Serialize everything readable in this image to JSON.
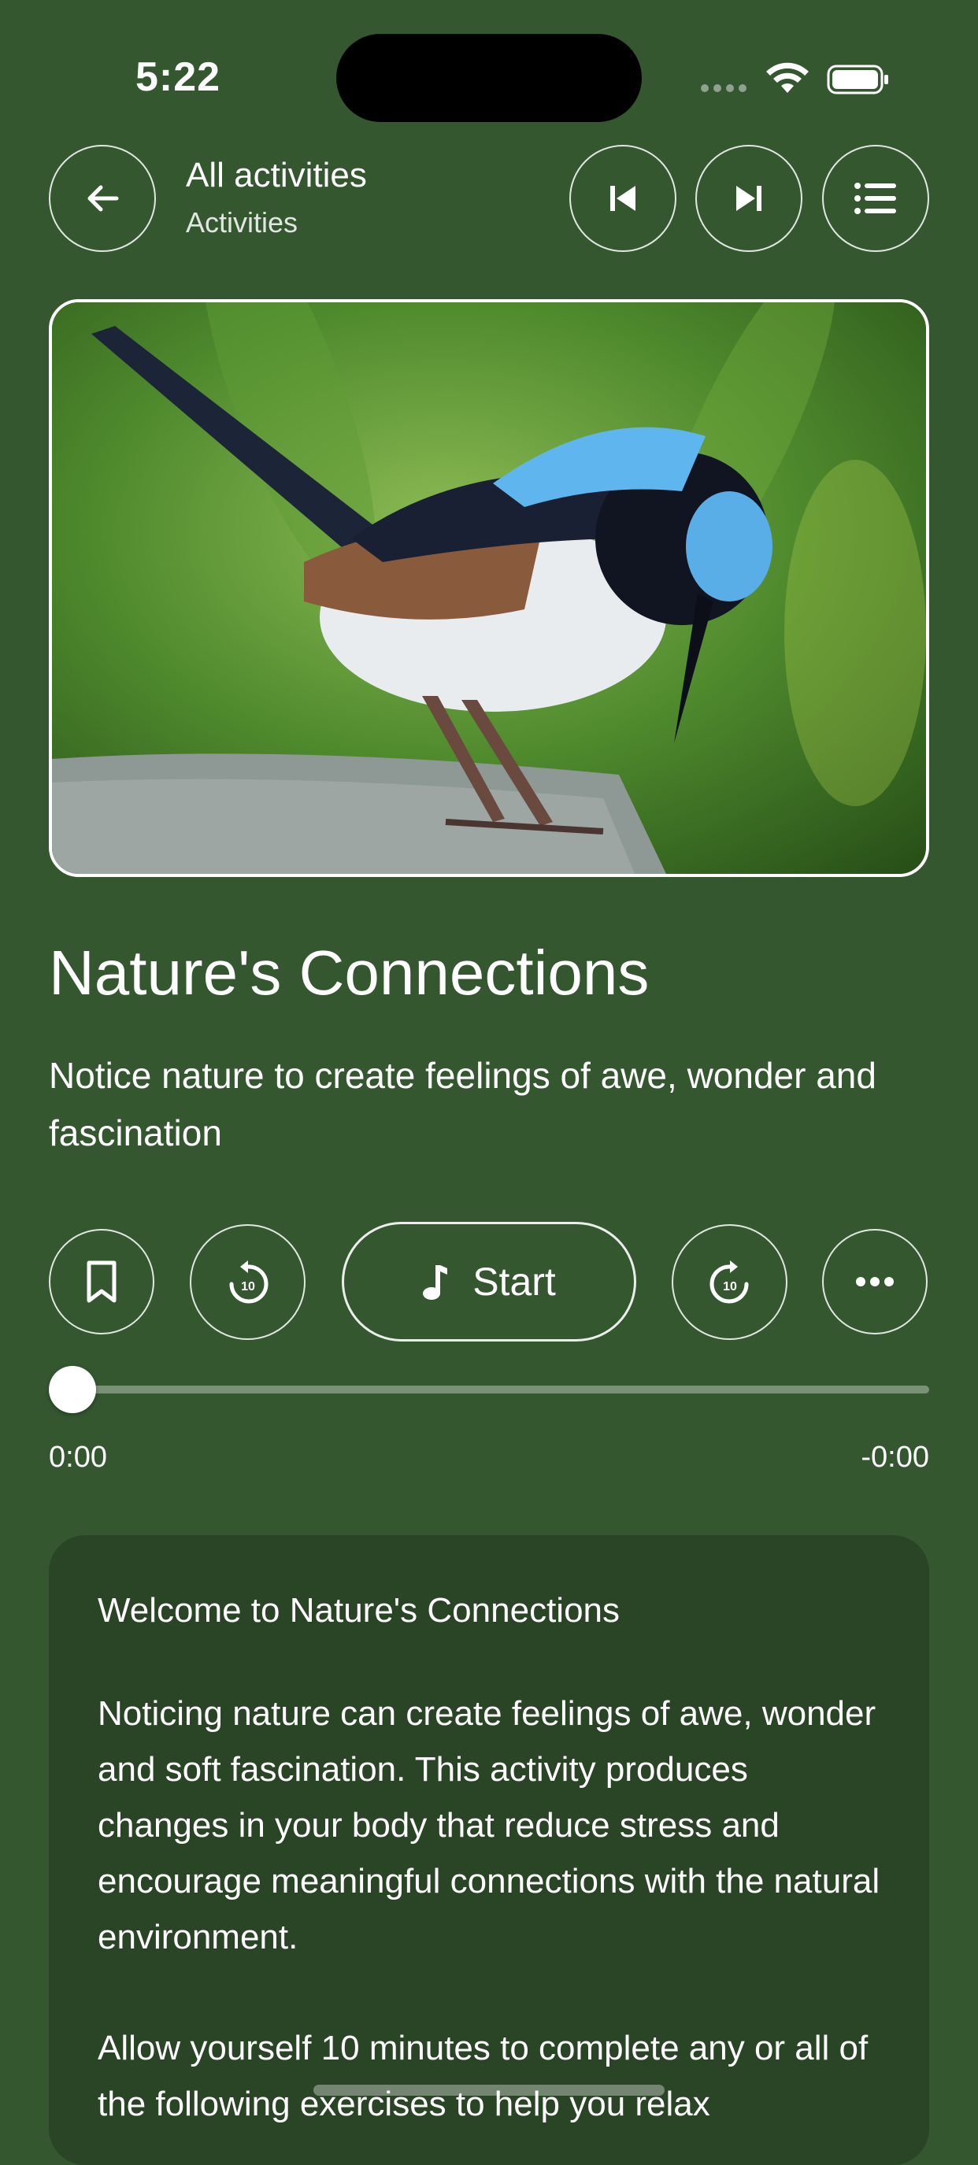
{
  "status_bar": {
    "time": "5:22"
  },
  "header": {
    "title": "All activities",
    "subtitle": "Activities",
    "icons": {
      "back": "arrow-left-icon",
      "previous": "skip-previous-icon",
      "next": "skip-next-icon",
      "list": "list-icon"
    }
  },
  "activity": {
    "title": "Nature's Connections",
    "description": "Notice nature to create feelings of awe, wonder and fascination",
    "image": "bird-photo"
  },
  "controls": {
    "start_label": "Start",
    "icons": {
      "bookmark": "bookmark-icon",
      "rewind": "rewind-10-icon",
      "music": "music-note-icon",
      "forward": "forward-10-icon",
      "more": "more-icon"
    }
  },
  "progress": {
    "elapsed": "0:00",
    "remaining": "-0:00",
    "fraction": 0
  },
  "info": {
    "heading": "Welcome to Nature's Connections",
    "paragraph1": "Noticing nature can create feelings of awe, wonder and soft fascination. This activity produces changes in your body that reduce stress and encourage meaningful connections with the natural environment.",
    "paragraph2": "Allow yourself 10 minutes to complete any or all of the following exercises to help you relax"
  },
  "colors": {
    "background": "#345730",
    "card": "#2a4526",
    "text": "#ffffff"
  }
}
